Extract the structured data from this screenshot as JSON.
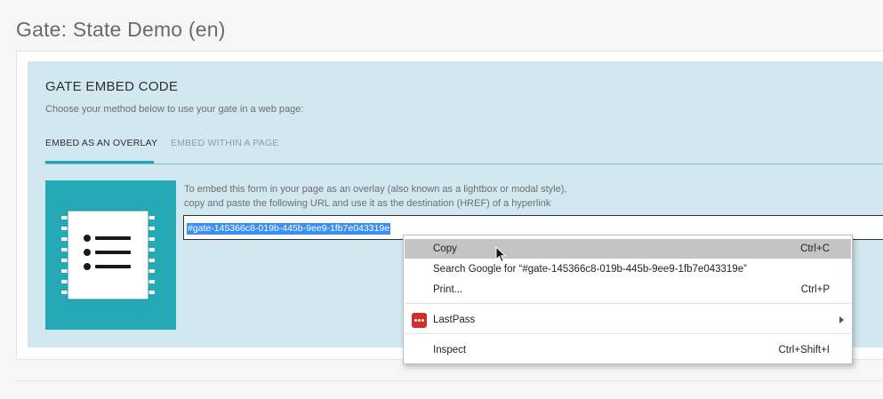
{
  "page": {
    "title": "Gate: State Demo (en)"
  },
  "embed": {
    "heading": "GATE EMBED CODE",
    "subtext": "Choose your method below to use your gate in a web page:",
    "tabs": [
      {
        "label": "EMBED AS AN OVERLAY",
        "active": true
      },
      {
        "label": "EMBED WITHIN A PAGE",
        "active": false
      }
    ],
    "instructions_line1": "To embed this form in your page as an overlay (also known as a lightbox or modal style),",
    "instructions_line2": "copy and paste the following URL and use it as the destination (HREF) of a hyperlink",
    "url_value": "#gate-145366c8-019b-445b-9ee9-1fb7e043319e",
    "thumb_icon": "list-icon"
  },
  "context_menu": {
    "items": [
      {
        "label": "Copy",
        "shortcut": "Ctrl+C",
        "highlighted": true
      },
      {
        "label": "Search Google for “#gate-145366c8-019b-445b-9ee9-1fb7e043319e”",
        "shortcut": ""
      },
      {
        "label": "Print...",
        "shortcut": "Ctrl+P"
      },
      {
        "label": "LastPass",
        "shortcut": "",
        "icon": "lastpass-icon",
        "submenu": true
      },
      {
        "label": "Inspect",
        "shortcut": "Ctrl+Shift+I"
      }
    ]
  },
  "colors": {
    "accent": "#25a9b6",
    "panel_bg": "#d2e8f1",
    "selection": "#3b8ef2",
    "lastpass_red": "#d32d27"
  }
}
